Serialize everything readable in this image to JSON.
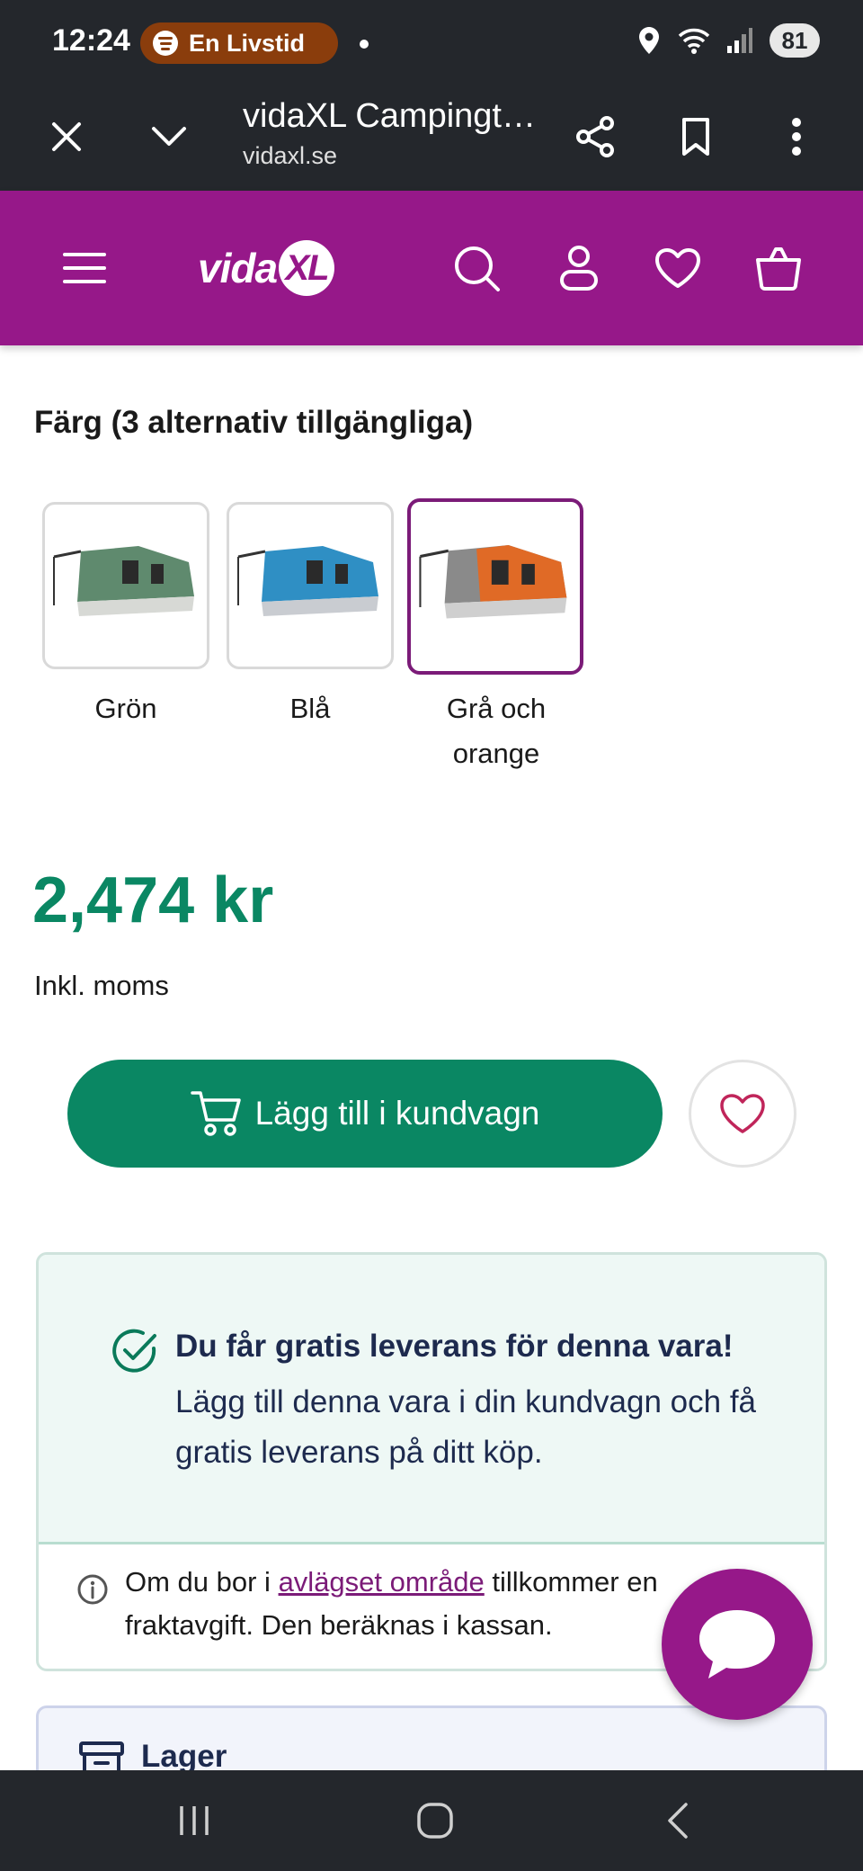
{
  "status_bar": {
    "time": "12:24",
    "media_pill": "En Livstid",
    "battery": "81"
  },
  "browser": {
    "page_title": "vidaXL Campingt…",
    "domain": "vidaxl.se"
  },
  "site_header": {
    "logo_text": "vida",
    "logo_badge": "XL",
    "brand_color": "#961889"
  },
  "product": {
    "color_heading": "Färg (3 alternativ tillgängliga)",
    "color_options": [
      {
        "label": "Grön",
        "selected": false,
        "tent_color": "#5f8a6e"
      },
      {
        "label": "Blå",
        "selected": false,
        "tent_color": "#2f8fc4"
      },
      {
        "label": "Grå och orange",
        "selected": true,
        "tent_color": "#e06a26"
      }
    ],
    "price": "2,474 kr",
    "vat_note": "Inkl. moms",
    "add_to_cart": "Lägg till i kundvagn",
    "price_color": "#0a8763"
  },
  "delivery": {
    "title": "Du får gratis leverans för denna vara!",
    "text": "Lägg till denna vara i din kundvagn och få gratis leverans på ditt köp.",
    "remote_prefix": "Om du bor i ",
    "remote_link": "avlägset område",
    "remote_suffix": " tillkommer en fraktavgift. Den beräknas i kassan."
  },
  "stock": {
    "label": "Lager"
  }
}
